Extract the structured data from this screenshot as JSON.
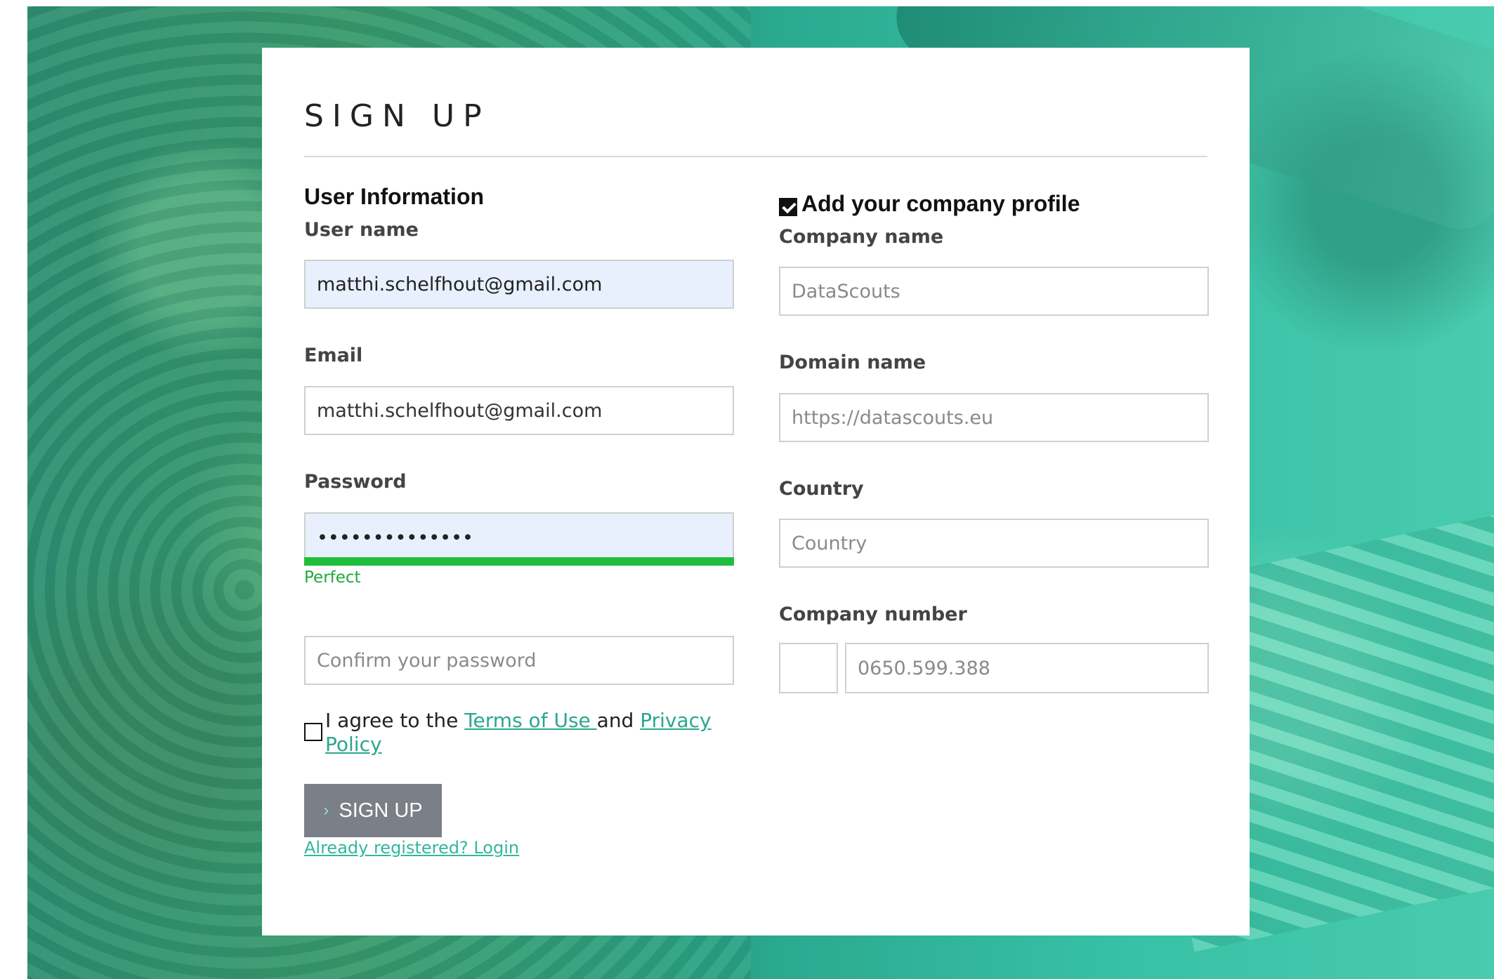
{
  "page": {
    "title": "SIGN UP"
  },
  "user_info": {
    "heading": "User Information",
    "username": {
      "label": "User name",
      "value": "matthi.schelfhout@gmail.com"
    },
    "email": {
      "label": "Email",
      "value": "matthi.schelfhout@gmail.com"
    },
    "password": {
      "label": "Password",
      "value": "••••••••••••••",
      "strength_label": "Perfect",
      "strength_color": "#1fbf3d"
    },
    "confirm_password": {
      "placeholder": "Confirm your password"
    },
    "agree": {
      "prefix": "I agree to the ",
      "terms_link": "Terms of Use ",
      "middle": "and ",
      "privacy_link": "Privacy Policy",
      "checked": false
    },
    "submit": {
      "label": "SIGN UP",
      "icon": "chevron-right-icon"
    },
    "login_link": "Already registered? Login"
  },
  "company": {
    "toggle_label": "Add your company profile",
    "toggle_checked": true,
    "company_name": {
      "label": "Company name",
      "placeholder": "DataScouts"
    },
    "domain_name": {
      "label": "Domain name",
      "placeholder": "https://datascouts.eu"
    },
    "country": {
      "label": "Country",
      "placeholder": "Country"
    },
    "company_number": {
      "label": "Company number",
      "placeholder": "0650.599.388"
    }
  },
  "colors": {
    "accent": "#2aa78e",
    "button": "#7b7f87",
    "autofill": "#e8f0fe"
  }
}
